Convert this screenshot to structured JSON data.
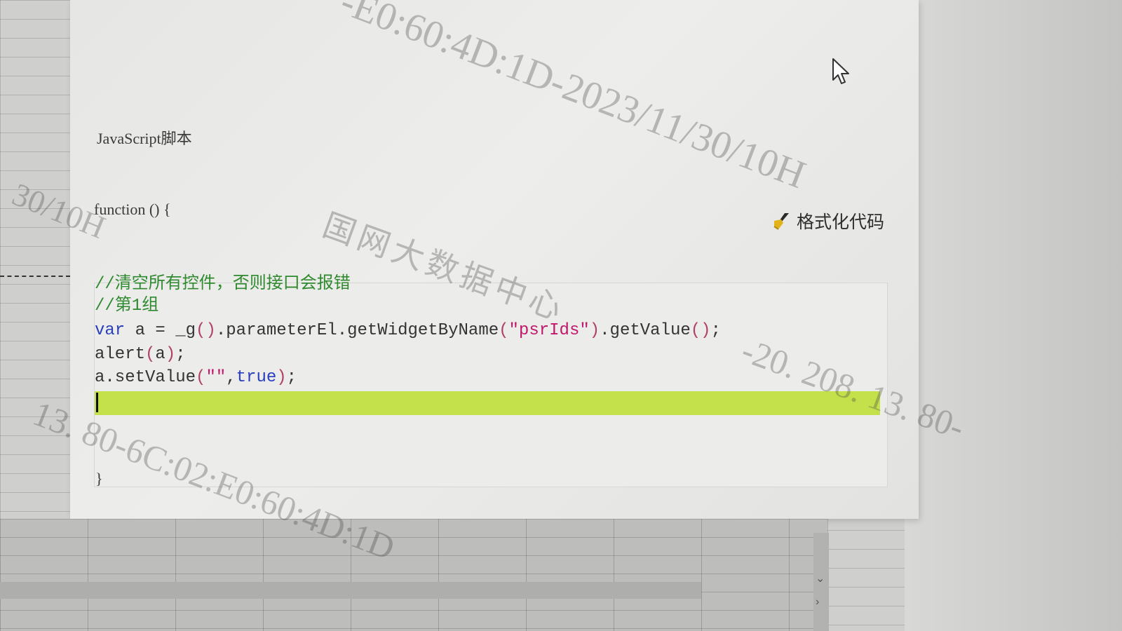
{
  "dialog": {
    "section_label": "JavaScript脚本",
    "function_open": "function () {",
    "function_close": "}",
    "format_button_label": "格式化代码"
  },
  "editor": {
    "comment1": "//清空所有控件，否则接口会报错",
    "comment2": "//第1组",
    "line3": {
      "kw": "var",
      "p1": " a = _g",
      "paren1": "()",
      "p2": ".parameterEl.getWidgetByName",
      "paren2": "(",
      "str": "\"psrIds\"",
      "paren3": ")",
      "p3": ".getValue",
      "paren4": "()",
      "p4": ";"
    },
    "line4": {
      "p1": "alert",
      "paren1": "(",
      "p2": "a",
      "paren2": ")",
      "p3": ";"
    },
    "line5": {
      "p1": "a.setValue",
      "paren1": "(",
      "str": "\"\"",
      "p2": ",",
      "kw": "true",
      "paren2": ")",
      "p3": ";"
    }
  },
  "watermark": {
    "line1": "-E0:60:4D:1D-2023/11/30/10H",
    "line2": "国网大数据中心",
    "line3": "-20. 208. 13. 80-",
    "line4": "13. 80-6C:02:E0:60:4D:1D",
    "line5": "30/10H"
  },
  "icons": {
    "format": "broom-icon",
    "pointer": "mouse-pointer-icon"
  },
  "colors": {
    "active_line": "#c4e04a",
    "comment": "#2f8a2f",
    "keyword": "#2a3fbf",
    "string": "#c2186b"
  }
}
